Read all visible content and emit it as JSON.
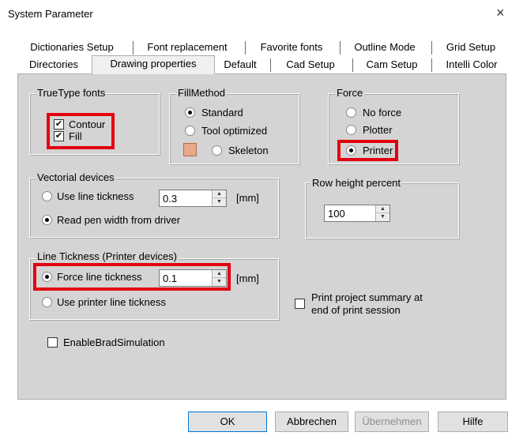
{
  "window": {
    "title": "System Parameter",
    "close_icon": "close-icon"
  },
  "tabs": {
    "row1": [
      "Dictionaries Setup",
      "Font replacement",
      "Favorite fonts",
      "Outline Mode",
      "Grid Setup"
    ],
    "row2": [
      "Directories",
      "Drawing properties",
      "Default",
      "Cad Setup",
      "Cam Setup",
      "Intelli Color"
    ],
    "active": "Drawing properties"
  },
  "truetype": {
    "legend": "TrueType fonts",
    "contour_label": "Contour",
    "contour_checked": true,
    "fill_label": "Fill",
    "fill_checked": true
  },
  "fillmethod": {
    "legend": "FillMethod",
    "options": [
      "Standard",
      "Tool optimized",
      "Skeleton"
    ],
    "selected": "Standard"
  },
  "force": {
    "legend": "Force",
    "options": [
      "No force",
      "Plotter",
      "Printer"
    ],
    "selected": "Printer"
  },
  "vectorial": {
    "legend": "Vectorial devices",
    "use_line_label": "Use line tickness",
    "line_value": "0.3",
    "unit": "[mm]",
    "read_pen_label": "Read pen width from driver",
    "selected": "Read pen width from driver"
  },
  "rowheight": {
    "legend": "Row height percent",
    "value": "100"
  },
  "linetickness": {
    "legend": "Line Tickness (Printer devices)",
    "force_label": "Force line tickness",
    "force_value": "0.1",
    "unit": "[mm]",
    "use_printer_label": "Use printer line tickness",
    "selected": "Force line tickness"
  },
  "print_summary": {
    "label_line1": "Print project summary at",
    "label_line2": "end of print session",
    "checked": false
  },
  "brad": {
    "label": "EnableBradSimulation",
    "checked": false
  },
  "buttons": {
    "ok": "OK",
    "cancel": "Abbrechen",
    "apply": "Übernehmen",
    "help": "Hilfe"
  },
  "colors": {
    "highlight": "#e3000f",
    "panel": "#d4d4d4",
    "active_tab": "#f0f0f0"
  }
}
